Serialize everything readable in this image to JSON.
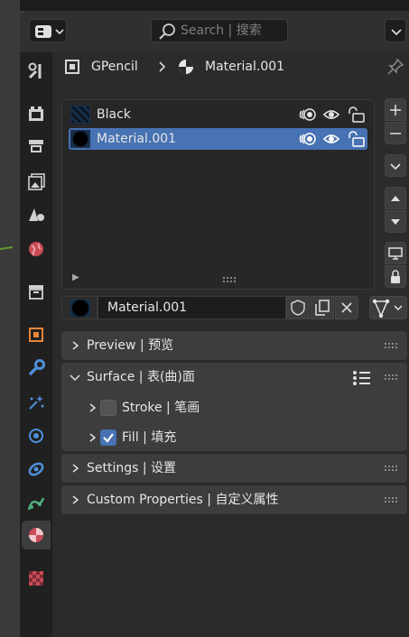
{
  "header": {
    "search_placeholder": "Search | 搜索"
  },
  "breadcrumb": {
    "object": "GPencil",
    "material": "Material.001"
  },
  "material_slots": [
    {
      "name": "Black",
      "selected": false
    },
    {
      "name": "Material.001",
      "selected": true
    }
  ],
  "material_field": {
    "value": "Material.001"
  },
  "panels": {
    "preview": "Preview | 预览",
    "surface": "Surface | 表(曲)面",
    "stroke": "Stroke | 笔画",
    "fill": "Fill | 填充",
    "settings": "Settings | 设置",
    "custom_properties": "Custom Properties | 自定义属性"
  },
  "checkboxes": {
    "stroke_checked": false,
    "fill_checked": true
  },
  "colors": {
    "accent": "#4772b3",
    "background": "#2b2b2b",
    "panel": "#3d3d3d"
  },
  "icons": [
    "editor-type-icon",
    "search-icon",
    "tool-icon",
    "render-icon",
    "output-icon",
    "view-layer-icon",
    "scene-icon",
    "world-icon",
    "collection-icon",
    "object-icon",
    "modifier-icon",
    "particles-icon",
    "physics-icon",
    "constraints-icon",
    "data-icon",
    "material-icon",
    "texture-icon",
    "pin-icon",
    "add-icon",
    "remove-icon",
    "move-up-icon",
    "move-down-icon",
    "screen-icon",
    "lock-icon",
    "fake-user-icon",
    "duplicate-icon",
    "close-icon",
    "list-icon",
    "onion-skin-icon",
    "eye-icon",
    "unlock-icon"
  ]
}
